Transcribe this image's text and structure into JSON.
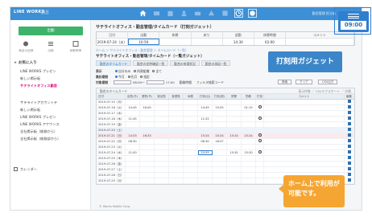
{
  "app": {
    "brand": "LINE WORKS",
    "brand_sub": "勤怠"
  },
  "topbar": {
    "icons": [
      "home-icon",
      "mail-icon",
      "calendar-icon",
      "contacts-icon",
      "drive-icon",
      "chat-icon",
      "board-icon",
      "clock-icon",
      "settings-icon"
    ],
    "user": "勤怠管理 担当者"
  },
  "sidebar": {
    "compose_label": "出勤",
    "quick": [
      {
        "icon": "record-icon",
        "label": "勤怠の記録"
      },
      {
        "icon": "list-icon",
        "label": "出勤"
      },
      {
        "icon": "request-icon",
        "label": "休暇申請"
      }
    ],
    "favorites_title": "お気に入り",
    "favorites": [
      "LINE WORKS プレゼン",
      "新しい掲示板",
      "サテライトオフィス勤怠"
    ],
    "groups": [
      "サテライトアカウントテ",
      "新しい掲示板",
      "LINE WORKS プレゼン",
      "LINE WORKS アナウンス",
      "全社掲示板（総務から）",
      "全社掲示板（総務部から）"
    ],
    "calendar_label": "カレンダー"
  },
  "main": {
    "title": "サテライトオフィス・勤怠管理/タイムカード（打刻ガジェット）",
    "punch": {
      "headers": [
        "日付",
        "出勤",
        "休憩",
        "戻り",
        "退勤",
        "休憩時間",
        "コメント"
      ],
      "values": [
        "2019-07-24（水）",
        "10:59",
        "",
        "",
        "14:30",
        "02:00",
        ""
      ]
    },
    "breadcrumb": "ホーム ＞ サテライトオフィス・勤怠管理 ＞ タイムカード（一覧）",
    "section_title": "サテライトオフィス・勤怠管理/タイムカード（一覧ガジェット）",
    "tabs": [
      "勤怠のタイムカード",
      "勤怠の定時確認一覧",
      "勤怠の申請状況",
      "勤怠の承認一覧"
    ],
    "filters": {
      "row1_label": "表示",
      "row1_opts": [
        "自分のみ",
        "所属組織",
        "全て"
      ],
      "row2_label": "集計期間",
      "row2_opts": [
        "今月",
        "先月",
        "指定"
      ],
      "row3_label": "対象期間",
      "row3_from": "08:00",
      "row3_to": "17:00",
      "row3_mid": "勤務時間",
      "row3_extra": "フィルタ検索コード",
      "search_label": "検索",
      "clear_label": "クリア",
      "csv_label": "CSV出力"
    },
    "grid": {
      "toolbar_left": "勤怠のタイムカード",
      "toolbar_right": "表示件数  ／ CSVエクスポート  ／ 印刷",
      "headers": [
        "日付",
        "出勤(予)",
        "退勤(予)",
        "実出勤",
        "実退勤",
        "休憩",
        "打刻(出)",
        "打刻(退)",
        "残業",
        "勤務",
        "打刻",
        "コメント",
        "編集"
      ],
      "rows": [
        {
          "date": "2019-07-15（月）",
          "vals": [
            "",
            "",
            "",
            "",
            "",
            "",
            "",
            "",
            ""
          ],
          "type": ""
        },
        {
          "date": "2019-07-16（火）",
          "vals": [
            "14:45",
            "16:00",
            "",
            "",
            "",
            "14:45",
            "15:55",
            "",
            "01:15"
          ],
          "type": ""
        },
        {
          "date": "2019-07-17（水）",
          "vals": [
            "",
            "",
            "",
            "",
            "",
            "",
            "",
            "",
            ""
          ],
          "type": ""
        },
        {
          "date": "2019-07-18（木）",
          "vals": [
            "11:45",
            "",
            "",
            "",
            "",
            "11:52",
            "",
            "",
            ""
          ],
          "type": ""
        },
        {
          "date": "2019-07-19（金）",
          "vals": [
            "",
            "",
            "",
            "",
            "",
            "",
            "",
            "",
            ""
          ],
          "type": ""
        },
        {
          "date": "2019-07-20（土）",
          "vals": [
            "",
            "",
            "",
            "",
            "",
            "",
            "",
            "",
            ""
          ],
          "type": "sat"
        },
        {
          "date": "2019-07-21（日）",
          "vals": [
            "14:33",
            "16:33",
            "",
            "",
            "",
            "15:24",
            "15:24",
            "15:24",
            "15:24"
          ],
          "type": "sun"
        },
        {
          "date": "2019-07-22（月）",
          "vals": [
            "08:30",
            "",
            "",
            "",
            "",
            "08:30",
            "18:07",
            "",
            ""
          ],
          "type": ""
        },
        {
          "date": "2019-07-23（火）",
          "vals": [
            "",
            "",
            "",
            "",
            "",
            "",
            "",
            "",
            ""
          ],
          "type": ""
        },
        {
          "date": "2019-07-24（水）",
          "vals": [
            "11:00",
            "",
            "",
            "",
            "",
            "10:59",
            "",
            "15:30",
            "15:30"
          ],
          "type": "hl"
        },
        {
          "date": "2019-07-25（木）",
          "vals": [
            "",
            "",
            "",
            "",
            "",
            "",
            "",
            "",
            ""
          ],
          "type": ""
        },
        {
          "date": "2019-07-26（金）",
          "vals": [
            "",
            "",
            "",
            "",
            "",
            "",
            "",
            "",
            ""
          ],
          "type": ""
        },
        {
          "date": "2019-07-27（土）",
          "vals": [
            "",
            "",
            "",
            "",
            "",
            "",
            "",
            "",
            ""
          ],
          "type": ""
        },
        {
          "date": "2019-07-28（日）",
          "vals": [
            "",
            "",
            "",
            "",
            "",
            "",
            "",
            "",
            ""
          ],
          "type": ""
        },
        {
          "date": "2019-07-29（月）",
          "vals": [
            "",
            "",
            "",
            "",
            "",
            "",
            "",
            "",
            ""
          ],
          "type": ""
        }
      ]
    }
  },
  "footer": "© Works Mobile Corp.",
  "callout_gadget": "打刻用ガジェット",
  "callout_home": "ホーム上で利用が可能です。",
  "gadget_time": "09:00",
  "colors": {
    "brand": "#3d8fd6",
    "accent": "#2f7fd0",
    "compose": "#3fb36b",
    "callout_orange": "#f5a531"
  }
}
